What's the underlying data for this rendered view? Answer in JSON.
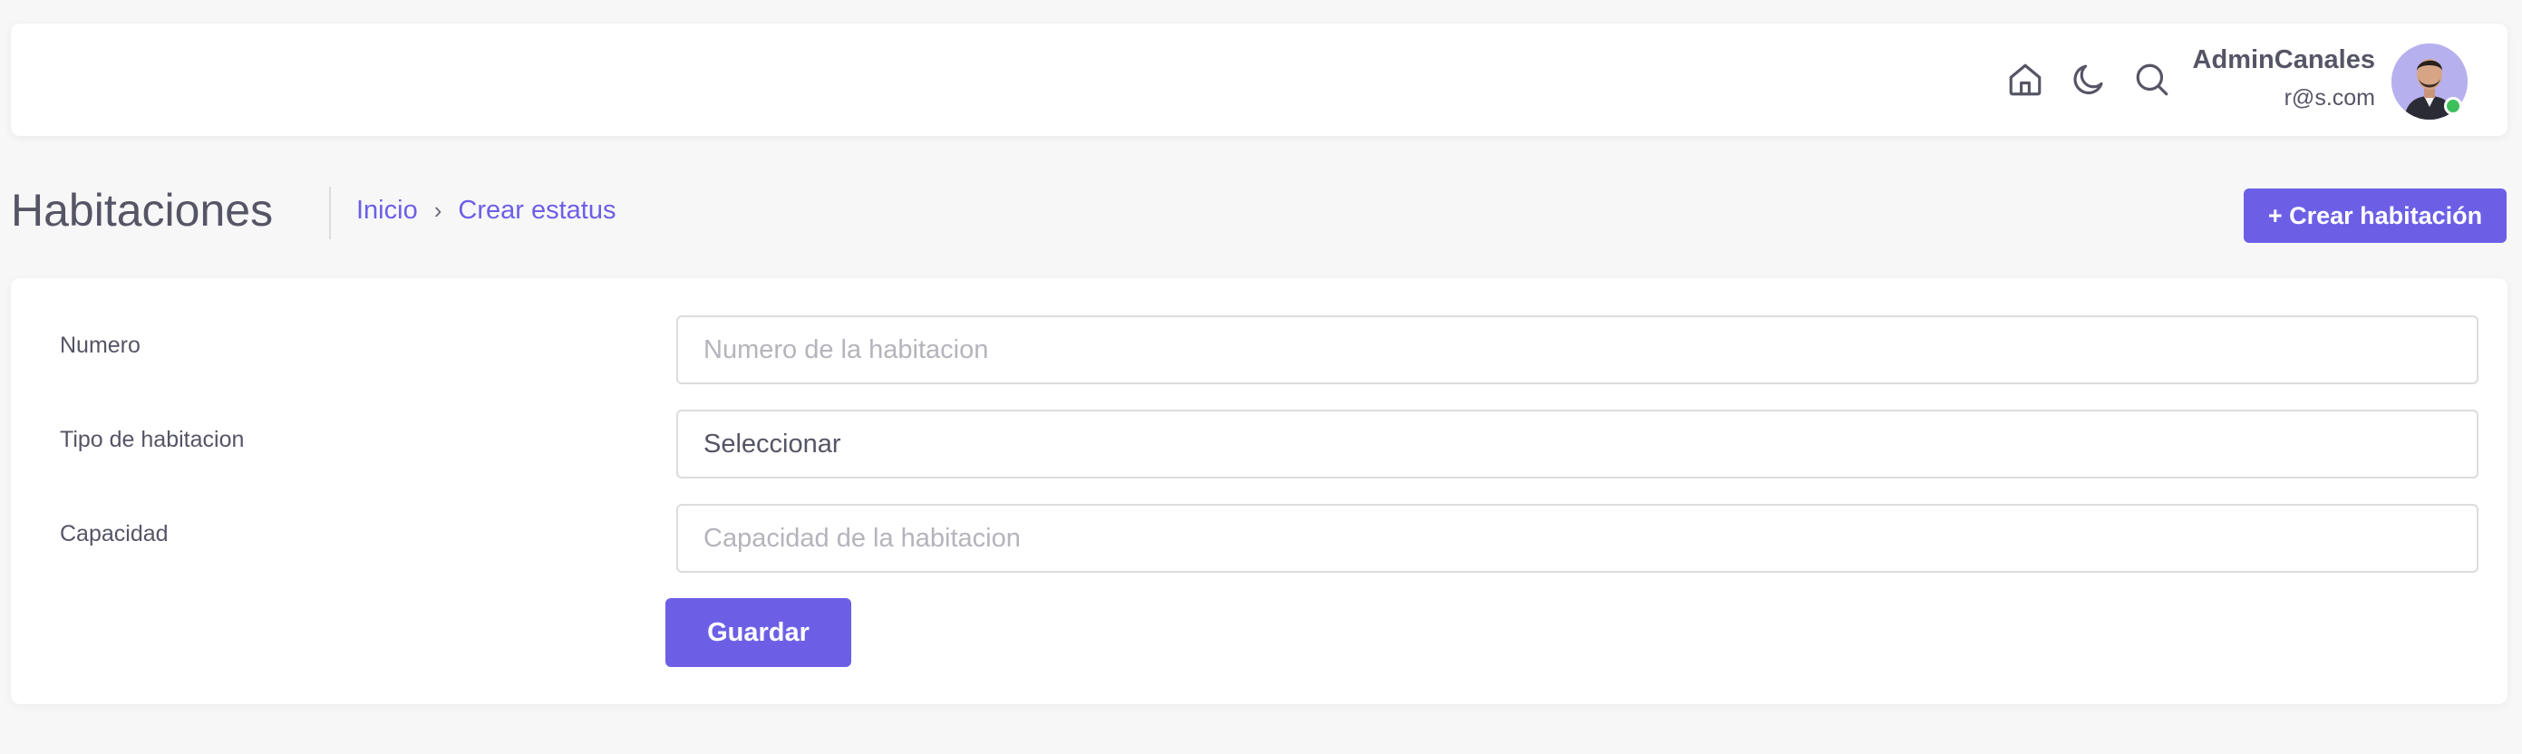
{
  "header": {
    "icons": [
      "home-icon",
      "moon-icon",
      "search-icon"
    ],
    "user": {
      "name": "AdminCanales",
      "email": "r@s.com",
      "status_color": "#3fbf5c"
    }
  },
  "page": {
    "title": "Habitaciones",
    "breadcrumb": {
      "home": "Inicio",
      "separator": "›",
      "current": "Crear estatus"
    },
    "create_button": "+ Crear habitación"
  },
  "form": {
    "numero": {
      "label": "Numero",
      "value": "",
      "placeholder": "Numero de la habitacion"
    },
    "tipo": {
      "label": "Tipo de habitacion",
      "selected": "Seleccionar"
    },
    "capacidad": {
      "label": "Capacidad",
      "value": "",
      "placeholder": "Capacidad de la habitacion"
    },
    "save_button": "Guardar"
  },
  "colors": {
    "accent": "#6c5fe6",
    "background": "#f7f7f7"
  }
}
